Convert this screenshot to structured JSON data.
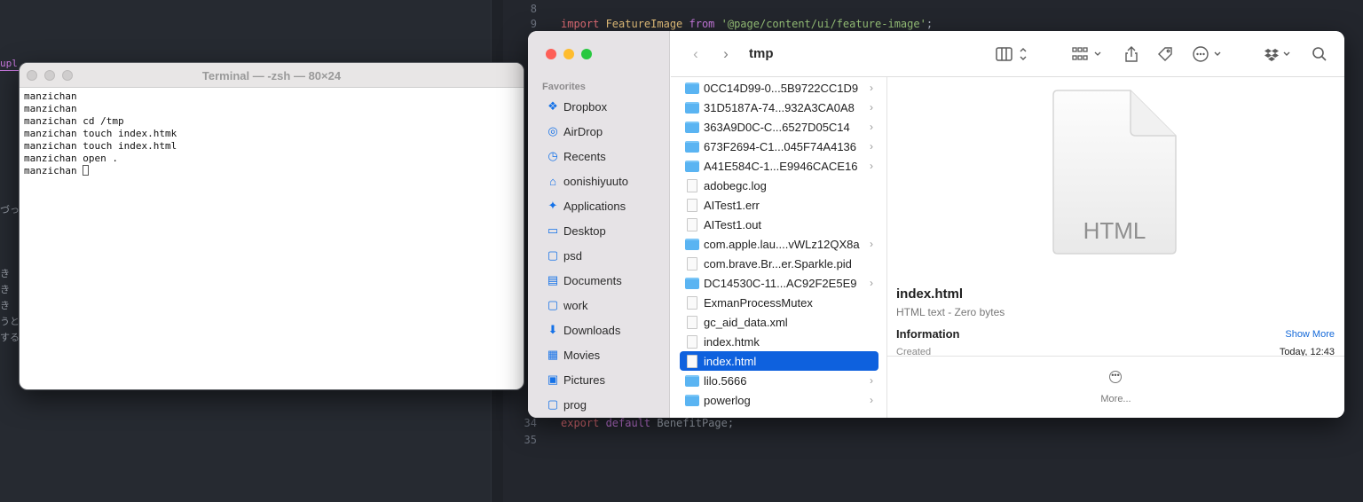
{
  "editor": {
    "right_lines": [
      {
        "num": "8",
        "parts": []
      },
      {
        "num": "9",
        "parts": [
          {
            "cls": "kw2",
            "t": "import "
          },
          {
            "cls": "id",
            "t": "FeatureImage "
          },
          {
            "cls": "kw",
            "t": "from "
          },
          {
            "cls": "str",
            "t": "'@page/content/ui/feature-image'"
          },
          {
            "cls": "plain",
            "t": ";"
          }
        ]
      },
      {
        "num": "34",
        "parts": [
          {
            "cls": "kw2",
            "t": "export "
          },
          {
            "cls": "kw",
            "t": "default "
          },
          {
            "cls": "plain",
            "t": "BenefitPage;"
          }
        ]
      },
      {
        "num": "35",
        "parts": []
      }
    ],
    "left_fragment": "upl",
    "left_jp": [
      "づっ",
      "き",
      "き",
      "き",
      "うと",
      "する"
    ]
  },
  "terminal": {
    "title": "Terminal — -zsh — 80×24",
    "lines": [
      "manzichan",
      "manzichan",
      "manzichan cd /tmp",
      "manzichan touch index.htmk",
      "manzichan touch index.html",
      "manzichan open ."
    ],
    "prompt": "manzichan "
  },
  "finder": {
    "title": "tmp",
    "traffic_colors": [
      "#fe5f57",
      "#febc2e",
      "#28c840"
    ],
    "sidebar_heading": "Favorites",
    "sidebar": [
      {
        "label": "Dropbox",
        "icon": "dropbox-icon"
      },
      {
        "label": "AirDrop",
        "icon": "airdrop-icon"
      },
      {
        "label": "Recents",
        "icon": "clock-icon"
      },
      {
        "label": "oonishiyuuto",
        "icon": "home-icon"
      },
      {
        "label": "Applications",
        "icon": "applications-icon"
      },
      {
        "label": "Desktop",
        "icon": "desktop-icon"
      },
      {
        "label": "psd",
        "icon": "folder-icon"
      },
      {
        "label": "Documents",
        "icon": "document-icon"
      },
      {
        "label": "work",
        "icon": "folder-icon"
      },
      {
        "label": "Downloads",
        "icon": "download-icon"
      },
      {
        "label": "Movies",
        "icon": "movie-icon"
      },
      {
        "label": "Pictures",
        "icon": "picture-icon"
      },
      {
        "label": "prog",
        "icon": "folder-icon"
      }
    ],
    "files": [
      {
        "name": "0CC14D99-0...5B9722CC1D9",
        "type": "folder"
      },
      {
        "name": "31D5187A-74...932A3CA0A8",
        "type": "folder"
      },
      {
        "name": "363A9D0C-C...6527D05C14",
        "type": "folder"
      },
      {
        "name": "673F2694-C1...045F74A4136",
        "type": "folder"
      },
      {
        "name": "A41E584C-1...E9946CACE16",
        "type": "folder"
      },
      {
        "name": "adobegc.log",
        "type": "file"
      },
      {
        "name": "AITest1.err",
        "type": "file"
      },
      {
        "name": "AITest1.out",
        "type": "file"
      },
      {
        "name": "com.apple.lau....vWLz12QX8a",
        "type": "folder"
      },
      {
        "name": "com.brave.Br...er.Sparkle.pid",
        "type": "file"
      },
      {
        "name": "DC14530C-11...AC92F2E5E9",
        "type": "folder"
      },
      {
        "name": "ExmanProcessMutex",
        "type": "file"
      },
      {
        "name": "gc_aid_data.xml",
        "type": "file"
      },
      {
        "name": "index.htmk",
        "type": "file"
      },
      {
        "name": "index.html",
        "type": "file",
        "selected": true
      },
      {
        "name": "lilo.5666",
        "type": "folder"
      },
      {
        "name": "powerlog",
        "type": "folder"
      }
    ],
    "preview": {
      "icon_text": "HTML",
      "name": "index.html",
      "kind": "HTML text - Zero bytes",
      "info_heading": "Information",
      "show_more": "Show More",
      "created_label": "Created",
      "created_value": "Today, 12:43",
      "more_label": "More..."
    }
  }
}
